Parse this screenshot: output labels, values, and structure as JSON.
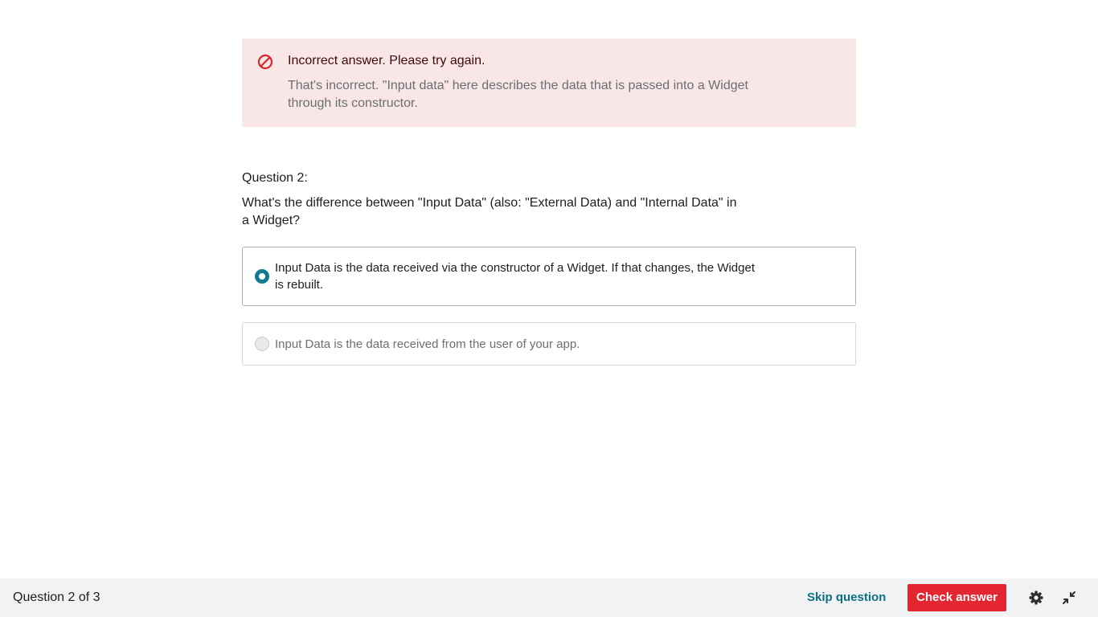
{
  "feedback": {
    "icon": "prohibited-icon",
    "title": "Incorrect answer. Please try again.",
    "body": "That's incorrect. \"Input data\" here describes the data that is passed into a Widget through its constructor.",
    "colors": {
      "background": "#f9e7e7",
      "icon": "#d7262f"
    }
  },
  "question": {
    "number_label": "Question 2:",
    "text": "What's the difference between \"Input Data\" (also: \"External Data) and \"Internal Data\" in a Widget?",
    "options": [
      {
        "label": "Input Data is the data received via the constructor of a Widget. If that changes, the Widget is rebuilt.",
        "selected": true
      },
      {
        "label": "Input Data is the data received from the user of your app.",
        "selected": false
      }
    ]
  },
  "footer": {
    "progress": "Question 2 of 3",
    "skip_label": "Skip question",
    "check_label": "Check answer",
    "settings_icon": "gear-icon",
    "collapse_icon": "collapse-icon",
    "colors": {
      "accent": "#0f6f82",
      "primary_button": "#e3262f",
      "background": "#f1f2f4"
    }
  }
}
